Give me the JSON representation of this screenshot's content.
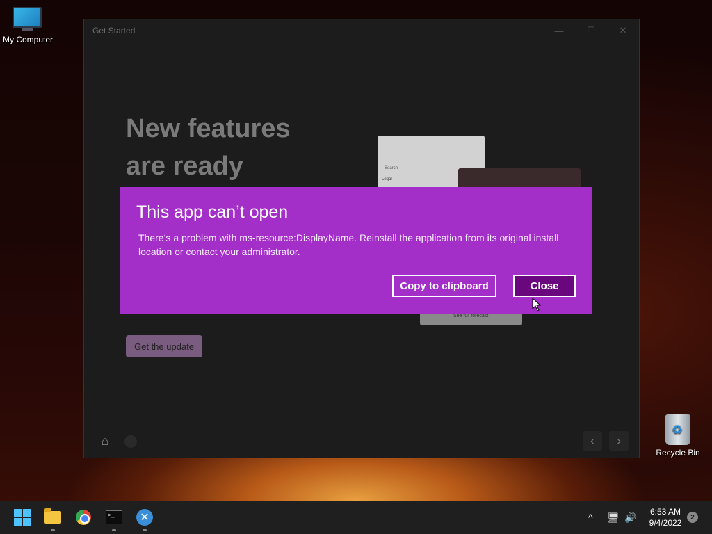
{
  "desktop": {
    "icons": [
      {
        "label": "My Computer",
        "icon": "monitor-icon"
      },
      {
        "label": "Recycle Bin",
        "icon": "recycle-bin-icon"
      }
    ]
  },
  "app_window": {
    "title": "Get Started",
    "controls": {
      "minimize": "—",
      "maximize": "☐",
      "close": "✕"
    },
    "headline_line1": "New features",
    "headline_line2": "are ready",
    "preview_search": "Search",
    "preview_legal": "Legal",
    "preview_forecast": "See full forecast",
    "get_update_label": "Get the update",
    "nav": {
      "home": "⌂",
      "prev": "‹",
      "next": "›"
    }
  },
  "dialog": {
    "title": "This app can’t open",
    "message": "There’s a problem with ms-resource:DisplayName. Reinstall the application from its original install location or contact your administrator.",
    "copy_label": "Copy to clipboard",
    "close_label": "Close",
    "background": "#a42ec8",
    "close_bg": "#6a067e"
  },
  "taskbar": {
    "apps": [
      "start-icon",
      "file-explorer-icon",
      "chrome-icon",
      "terminal-icon",
      "xapp-icon"
    ],
    "terminal_glyph": ">_",
    "xapp_glyph": "✕",
    "tray": {
      "chevron": "^",
      "network": "🖥",
      "volume": "🔊"
    },
    "clock_time": "6:53 AM",
    "clock_date": "9/4/2022",
    "notification_count": "2"
  }
}
